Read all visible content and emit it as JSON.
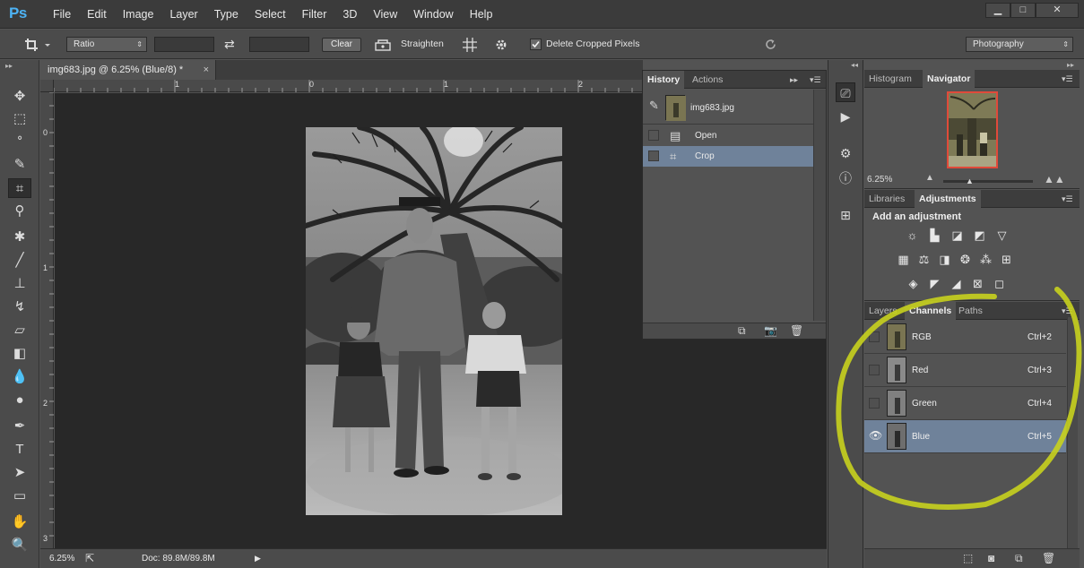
{
  "app": {
    "logo": "Ps"
  },
  "menu": [
    "File",
    "Edit",
    "Image",
    "Layer",
    "Type",
    "Select",
    "Filter",
    "3D",
    "View",
    "Window",
    "Help"
  ],
  "window_controls": {
    "minimize": "▁",
    "maximize": "□",
    "close": "✕"
  },
  "options_bar": {
    "ratio_label": "Ratio",
    "swap_glyph": "⇄",
    "clear_label": "Clear",
    "straighten_label": "Straighten",
    "delete_cropped_label": "Delete Cropped Pixels",
    "delete_cropped_checked": true,
    "workspace": "Photography"
  },
  "document": {
    "tab_title": "img683.jpg @ 6.25% (Blue/8) *",
    "close_glyph": "×",
    "ruler_h": [
      "1",
      "0",
      "1",
      "2"
    ],
    "ruler_v": [
      "0",
      "1",
      "2",
      "3"
    ]
  },
  "status": {
    "zoom": "6.25%",
    "doc": "Doc: 89.8M/89.8M"
  },
  "history_panel": {
    "tabs": [
      "History",
      "Actions"
    ],
    "snapshot_name": "img683.jpg",
    "items": [
      {
        "label": "Open",
        "selected": false
      },
      {
        "label": "Crop",
        "selected": true
      }
    ]
  },
  "top_right_panel": {
    "tabs": [
      "Histogram",
      "Navigator"
    ],
    "active_tab": "Navigator",
    "zoom": "6.25%"
  },
  "adjustments_panel": {
    "tabs": [
      "Libraries",
      "Adjustments"
    ],
    "active_tab": "Adjustments",
    "title": "Add an adjustment"
  },
  "channels_panel": {
    "tabs": [
      "Layers",
      "Channels",
      "Paths"
    ],
    "active_tab": "Channels",
    "channels": [
      {
        "name": "RGB",
        "shortcut": "Ctrl+2",
        "visible": false,
        "selected": false
      },
      {
        "name": "Red",
        "shortcut": "Ctrl+3",
        "visible": false,
        "selected": false
      },
      {
        "name": "Green",
        "shortcut": "Ctrl+4",
        "visible": false,
        "selected": false
      },
      {
        "name": "Blue",
        "shortcut": "Ctrl+5",
        "visible": true,
        "selected": true
      }
    ]
  },
  "colors": {
    "selection": "#6f829a",
    "annotation": "#c8d21e",
    "ps_blue": "#4db3f5",
    "nav_frame": "#e04a3a"
  }
}
